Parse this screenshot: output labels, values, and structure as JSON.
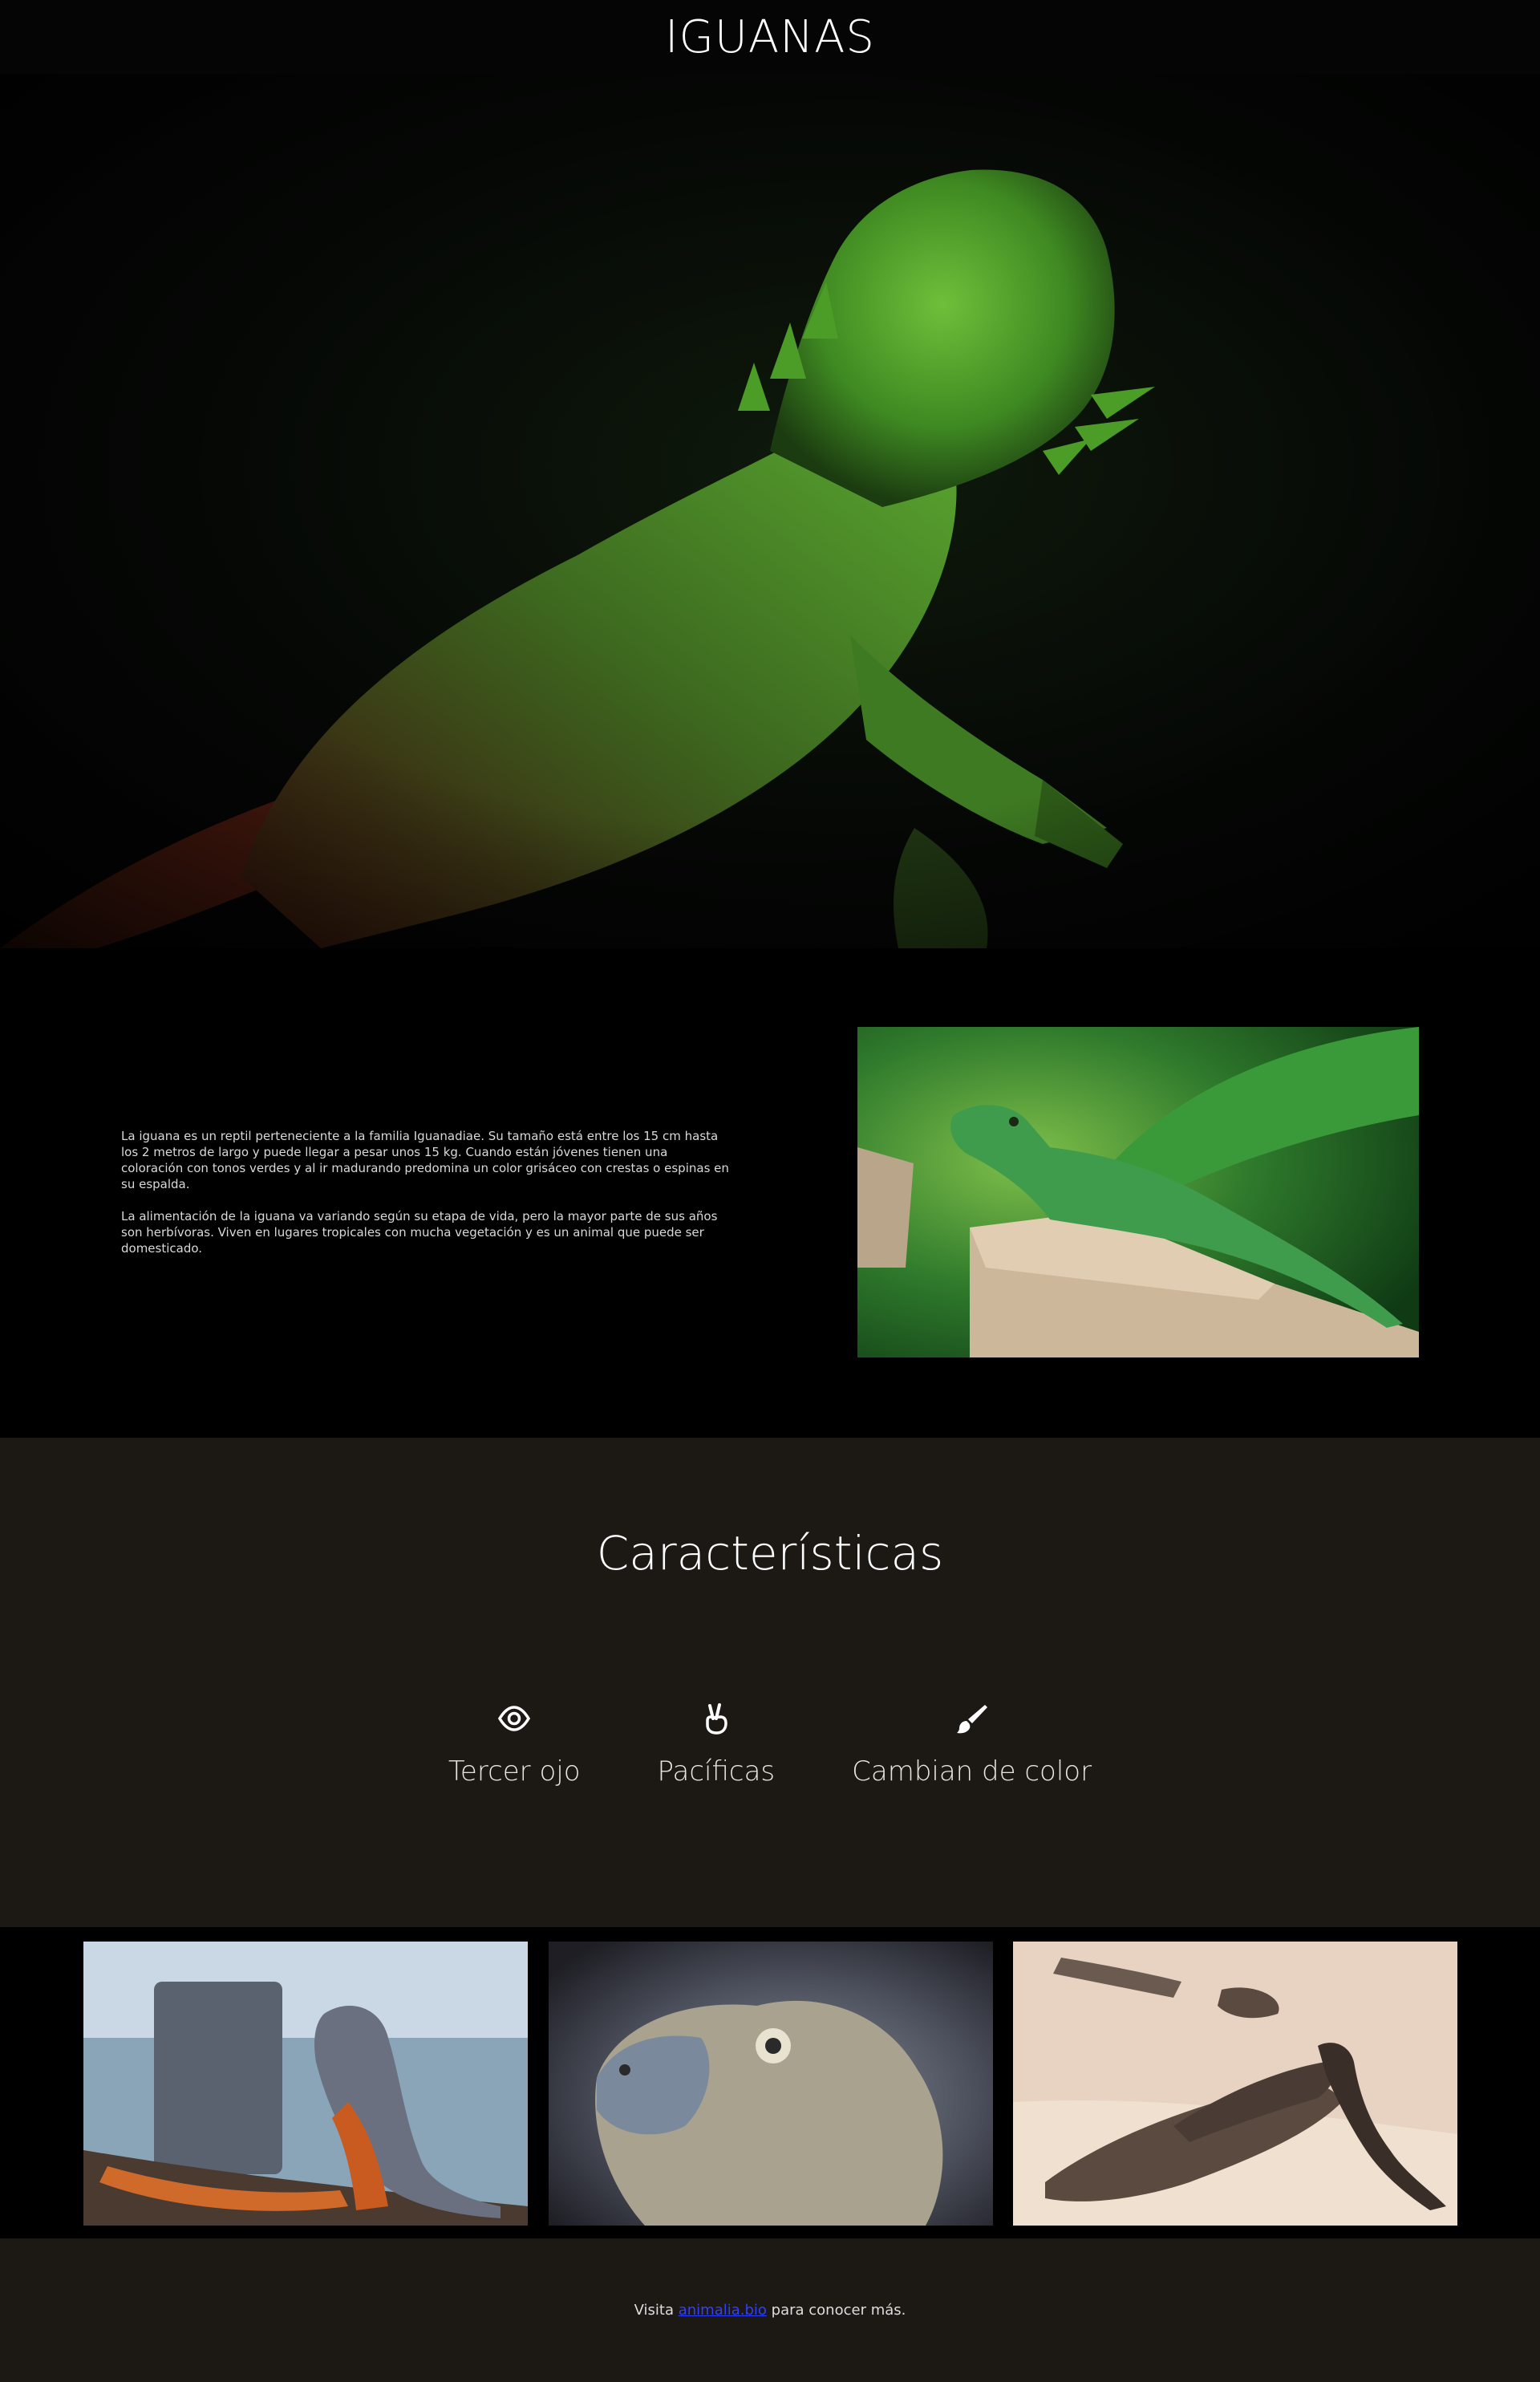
{
  "header": {
    "title": "IGUANAS"
  },
  "about": {
    "paragraph_1": "La iguana es un reptil perteneciente a la familia Iguanadiae. Su tamaño está entre los 15 cm hasta los 2 metros de largo y puede llegar a pesar unos 15 kg. Cuando están jóvenes tienen una coloración con tonos verdes y al ir madurando predomina un color grisáceo con crestas o espinas en su espalda.",
    "paragraph_2": "La alimentación de la iguana va variando según su etapa de vida, pero la mayor parte de sus años son herbívoras. Viven en lugares tropicales con mucha vegetación y es un animal que puede ser domesticado."
  },
  "features": {
    "title": "Características",
    "items": [
      {
        "label": "Tercer ojo",
        "icon": "eye-icon"
      },
      {
        "label": "Pacíficas",
        "icon": "peace-hand-icon"
      },
      {
        "label": "Cambian de color",
        "icon": "paintbrush-icon"
      }
    ]
  },
  "footer": {
    "prefix": "Visita ",
    "link_text": "animalia.bio",
    "suffix": " para conocer más."
  },
  "colors": {
    "header_bg": "#050505",
    "section_dark": "#000000",
    "section_brown": "#1c1814",
    "link": "#3040ff"
  }
}
